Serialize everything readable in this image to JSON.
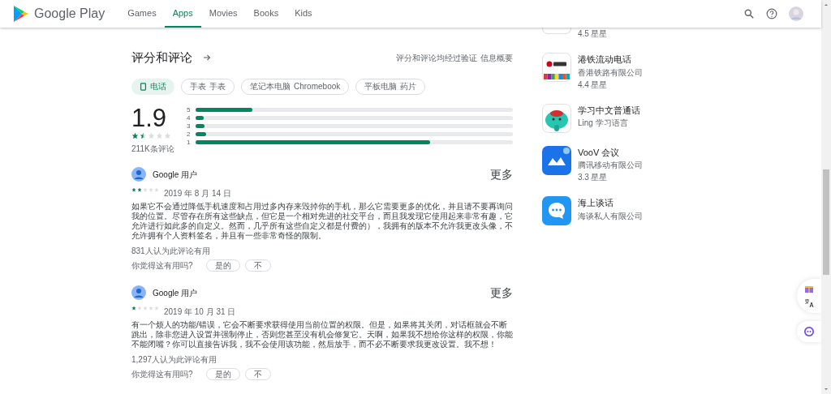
{
  "header": {
    "brand": "Google Play",
    "nav": [
      {
        "label": "Games",
        "selected": false
      },
      {
        "label": "Apps",
        "selected": true
      },
      {
        "label": "Movies",
        "selected": false
      },
      {
        "label": "Books",
        "selected": false
      },
      {
        "label": "Kids",
        "selected": false
      }
    ]
  },
  "ratings": {
    "title": "评分和评论",
    "verified_note": "评分和评论均经过验证",
    "info_link": "信息概要",
    "devices": [
      {
        "label": "电话",
        "selected": true
      },
      {
        "label": "手表",
        "sub": "手表",
        "selected": false
      },
      {
        "label": "笔记本电脑",
        "sub": "Chromebook",
        "selected": false
      },
      {
        "label": "平板电脑",
        "sub": "药片",
        "selected": false
      }
    ],
    "score": "1.9",
    "stars": 1.5,
    "count": "211K条评论",
    "bars": [
      {
        "label": "5",
        "level": 0.18
      },
      {
        "label": "4",
        "level": 0.026
      },
      {
        "label": "3",
        "level": 0.028
      },
      {
        "label": "2",
        "level": 0.034
      },
      {
        "label": "1",
        "level": 0.74
      }
    ]
  },
  "reviews": [
    {
      "author": "Google 用户",
      "more": "更多",
      "stars": 2,
      "date": "2019 年 8 月 14 日",
      "text": "如果它不会通过降低手机速度和占用过多内存来毁掉你的手机，那么它需要更多的优化，并且请不要再询问我的位置。尽管存在所有这些缺点，但它是一个相对先进的社交平台，而且我发现它使用起来非常有趣，它允许进行如此多的自定义。然而，几乎所有这些自定义都是付费的），我拥有的版本不允许我更改头像，不允许拥有个人资料签名，并且有一些非常奇怪的限制。",
      "helpful_count": "831人认为此评论有用",
      "helpful_question": "你觉得这有用吗?",
      "yes": "是的",
      "no": "不"
    },
    {
      "author": "Google 用户",
      "more": "更多",
      "stars": 1,
      "date": "2019 年 10 月 31 日",
      "text": "有一个烦人的功能/错误，它会不断要求获得使用当前位置的权限。但是，如果将其关闭，对话框就会不断跳出，除非您进入设置并强制停止，否则您甚至没有机会修复它。天啊，如果我不想给你这样的权限，你能不能闭嘴？你可以直接告诉我，我不会使用该功能，然后放手，而不必不断要求我更改设置。我不想！",
      "helpful_count": "1,297人认为此评论有用",
      "helpful_question": "你觉得这有用吗?",
      "yes": "是的",
      "no": "不"
    }
  ],
  "similar_apps": [
    {
      "kind": "cut",
      "rating": "4.5",
      "rating_unit": "星星"
    },
    {
      "kind": "mtr",
      "name": "港铁流动电话",
      "developer": "香港铁路有限公司",
      "rating": "4.4",
      "rating_unit": "星星"
    },
    {
      "kind": "ling",
      "name": "学习中文普通话",
      "developer": "Ling 学习语言"
    },
    {
      "kind": "voov",
      "name": "VooV 会议",
      "developer": "腾讯移动有限公司",
      "rating": "3.3",
      "rating_unit": "星星"
    },
    {
      "kind": "chat",
      "name": "海上谈话",
      "developer": "海谈私人有限公司"
    }
  ]
}
